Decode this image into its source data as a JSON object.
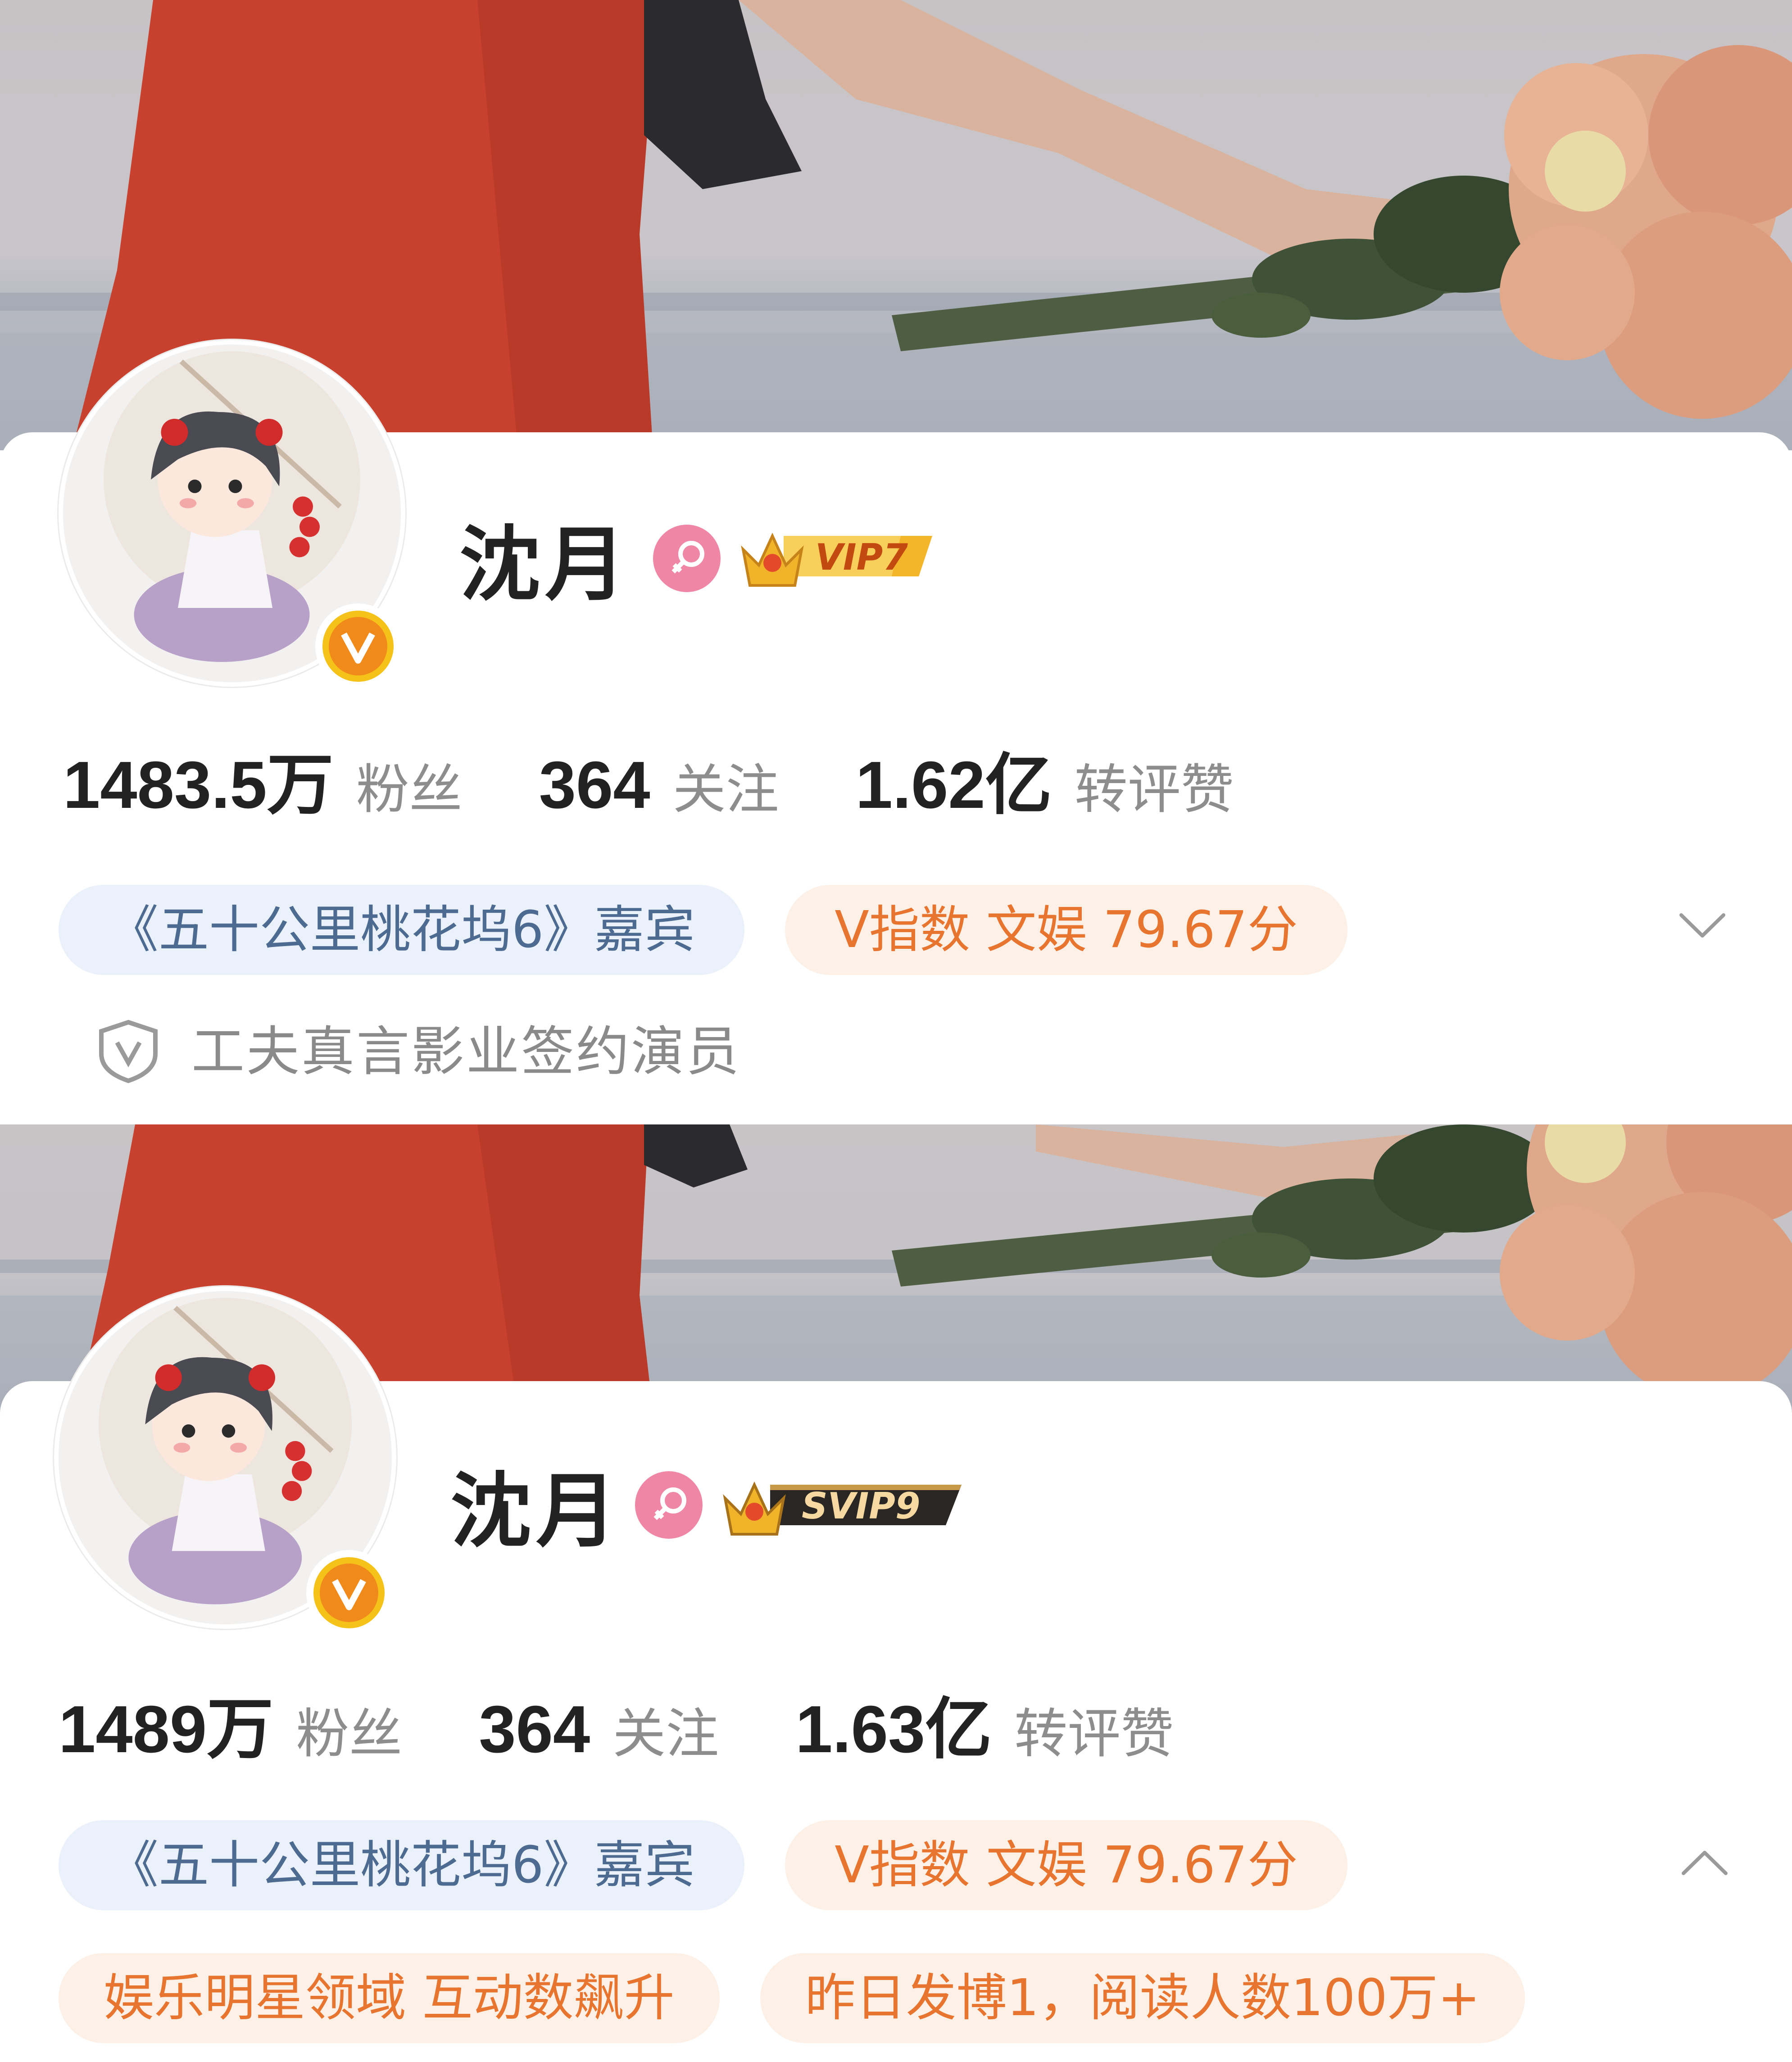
{
  "profile_before": {
    "name": "沈月",
    "vip_label": "VIP7",
    "stats": [
      {
        "value": "1483.5万",
        "label": "粉丝"
      },
      {
        "value": "364",
        "label": "关注"
      },
      {
        "value": "1.62亿",
        "label": "转评赞"
      }
    ],
    "tags": [
      "《五十公里桃花坞6》嘉宾",
      "V指数 文娱 79.67分"
    ],
    "verification": "工夫真言影业签约演员"
  },
  "profile_after": {
    "name": "沈月",
    "vip_label": "SVIP9",
    "stats": [
      {
        "value": "1489万",
        "label": "粉丝"
      },
      {
        "value": "364",
        "label": "关注"
      },
      {
        "value": "1.63亿",
        "label": "转评赞"
      }
    ],
    "tags": [
      "《五十公里桃花坞6》嘉宾",
      "V指数 文娱 79.67分"
    ],
    "tags_row2": [
      "娱乐明星领域 互动数飙升",
      "昨日发博1，阅读人数100万+"
    ]
  },
  "icons": {
    "gender": "female-icon",
    "verified": "verified-v-icon",
    "expand": "chevron-down-icon",
    "collapse": "chevron-up-icon",
    "verification": "shield-v-icon"
  },
  "colors": {
    "gender_pink": "#ef86a6",
    "verified_orange": "#f08a1a",
    "tag_blue_text": "#4d6a91",
    "tag_orange_text": "#e7752f"
  }
}
